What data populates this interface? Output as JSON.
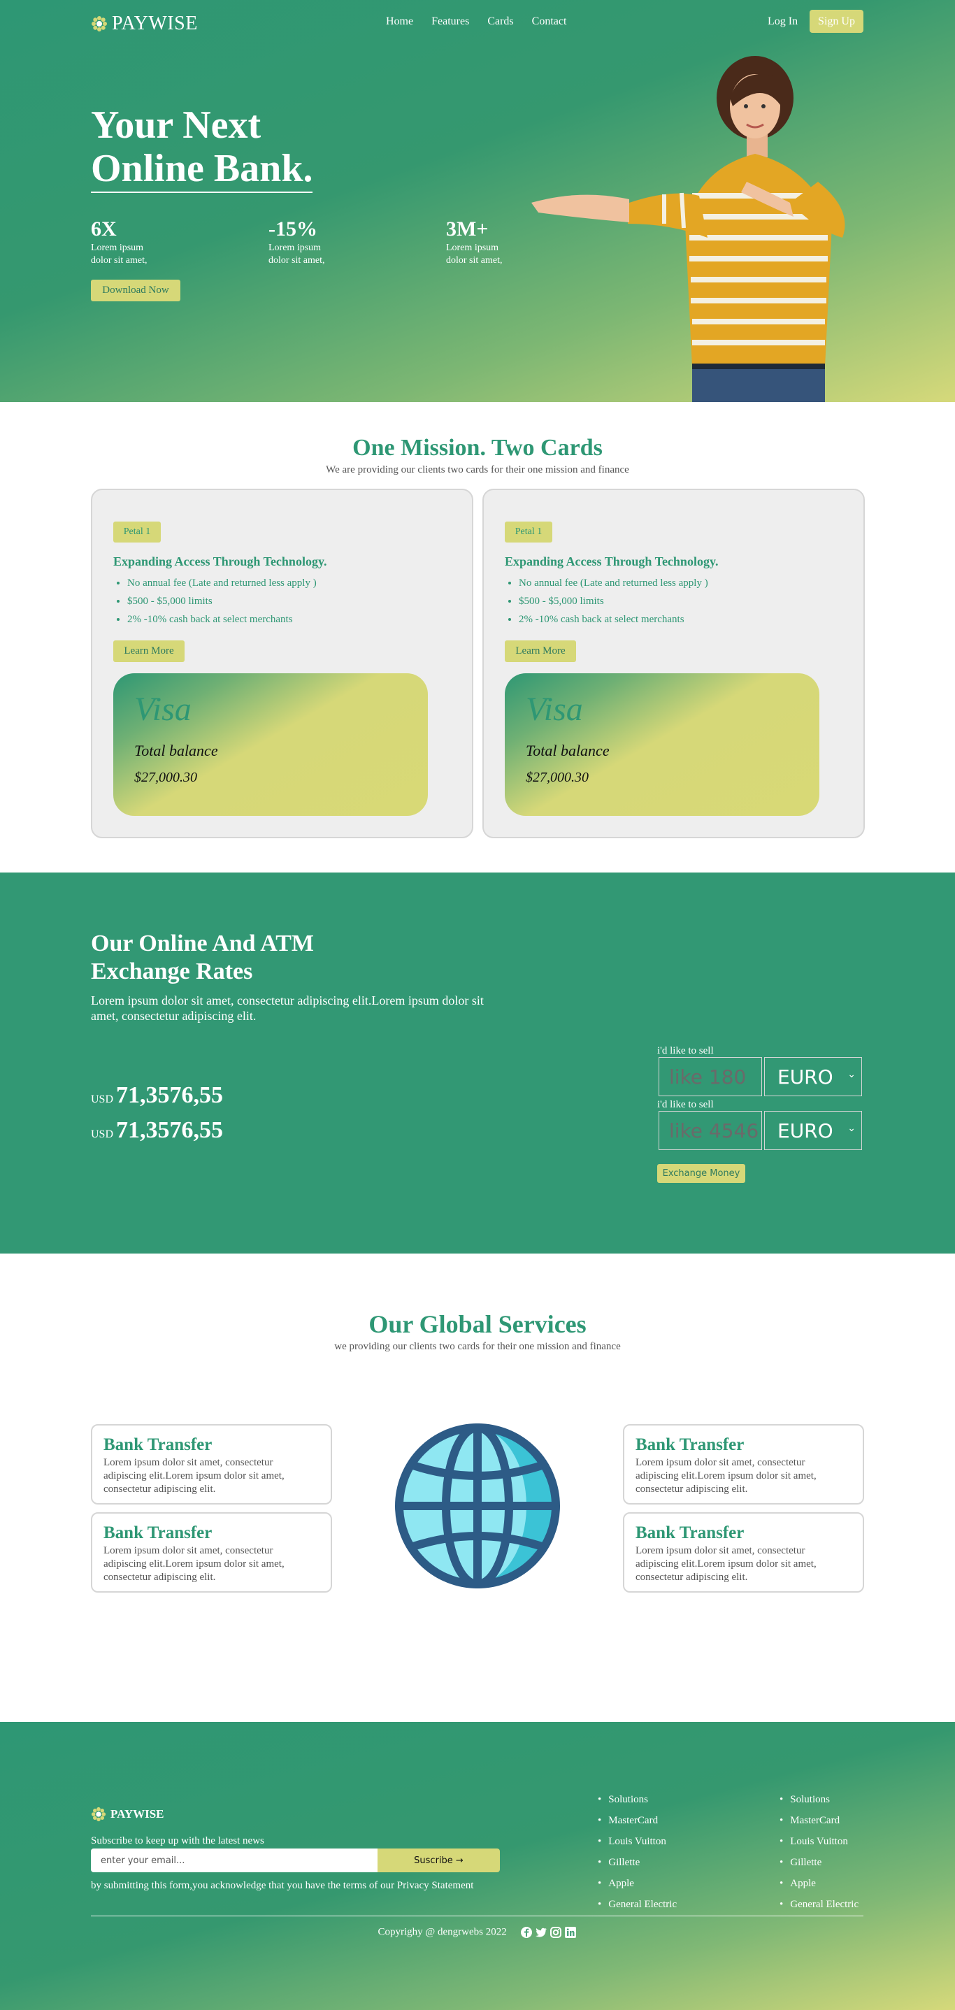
{
  "nav": {
    "brand": "PAYWISE",
    "links": [
      "Home",
      "Features",
      "Cards",
      "Contact"
    ],
    "login": "Log In",
    "signup": "Sign Up"
  },
  "hero": {
    "title_line1": "Your Next",
    "title_line2": "Online Bank.",
    "stats": [
      {
        "value": "6X",
        "line1": "Lorem ipsum",
        "line2": "dolor sit amet,"
      },
      {
        "value": "-15%",
        "line1": "Lorem ipsum",
        "line2": "dolor sit amet,"
      },
      {
        "value": "3M+",
        "line1": "Lorem ipsum",
        "line2": "dolor sit amet,"
      }
    ],
    "download": "Download Now"
  },
  "cards_section": {
    "title": "One Mission. Two Cards",
    "subtitle": "We are providing our clients two cards for their one mission and finance",
    "cards": [
      {
        "badge": "Petal 1",
        "heading": "Expanding Access Through Technology.",
        "bullets": [
          "No annual fee (Late and returned less apply )",
          "$500 - $5,000 limits",
          "2% -10% cash back at select merchants"
        ],
        "button": "Learn More",
        "card_brand": "Visa",
        "balance_label": "Total balance",
        "balance": "$27,000.30"
      },
      {
        "badge": "Petal 1",
        "heading": "Expanding Access Through Technology.",
        "bullets": [
          "No annual fee (Late and returned less apply )",
          "$500 - $5,000 limits",
          "2% -10% cash back at select merchants"
        ],
        "button": "Learn More",
        "card_brand": "Visa",
        "balance_label": "Total balance",
        "balance": "$27,000.30"
      }
    ]
  },
  "rates": {
    "title_line1": "Our Online And ATM",
    "title_line2": "Exchange Rates",
    "description": "Lorem ipsum dolor sit amet, consectetur adipiscing elit.Lorem ipsum dolor sit amet, consectetur adipiscing elit.",
    "values": [
      {
        "currency": "USD",
        "amount": "71,3576,55"
      },
      {
        "currency": "USD",
        "amount": "71,3576,55"
      }
    ],
    "converters": [
      {
        "label": "i'd like to sell",
        "placeholder": "like 180",
        "currency": "EURO"
      },
      {
        "label": "i'd like to sell",
        "placeholder": "like 4546",
        "currency": "EURO"
      }
    ],
    "exchange_button": "Exchange Money"
  },
  "services": {
    "title": "Our Global Services",
    "subtitle": "we providing our clients two cards for their one mission and finance",
    "items": [
      {
        "title": "Bank Transfer",
        "text": "Lorem ipsum dolor sit amet, consectetur adipiscing elit.Lorem ipsum dolor sit amet, consectetur adipiscing elit."
      },
      {
        "title": "Bank Transfer",
        "text": "Lorem ipsum dolor sit amet, consectetur adipiscing elit.Lorem ipsum dolor sit amet, consectetur adipiscing elit."
      },
      {
        "title": "Bank Transfer",
        "text": "Lorem ipsum dolor sit amet, consectetur adipiscing elit.Lorem ipsum dolor sit amet, consectetur adipiscing elit."
      },
      {
        "title": "Bank Transfer",
        "text": "Lorem ipsum dolor sit amet, consectetur adipiscing elit.Lorem ipsum dolor sit amet, consectetur adipiscing elit."
      }
    ]
  },
  "footer": {
    "brand": "PAYWISE",
    "subscribe_text": "Subscribe to keep up with the latest news",
    "email_placeholder": "enter your email...",
    "subscribe_button": "Suscribe →",
    "note": "by submitting this form,you acknowledge that you have the terms of our Privacy Statement",
    "col1": [
      "Solutions",
      "MasterCard",
      "Louis Vuitton",
      "Gillette",
      "Apple",
      "General Electric"
    ],
    "col2": [
      "Solutions",
      "MasterCard",
      "Louis Vuitton",
      "Gillette",
      "Apple",
      "General Electric"
    ],
    "copyright": "Copyrighy @ dengrwebs 2022",
    "social_icons": [
      "facebook-icon",
      "twitter-icon",
      "instagram-icon",
      "linkedin-icon"
    ]
  },
  "colors": {
    "primary": "#2e9774",
    "accent": "#d6d878"
  }
}
